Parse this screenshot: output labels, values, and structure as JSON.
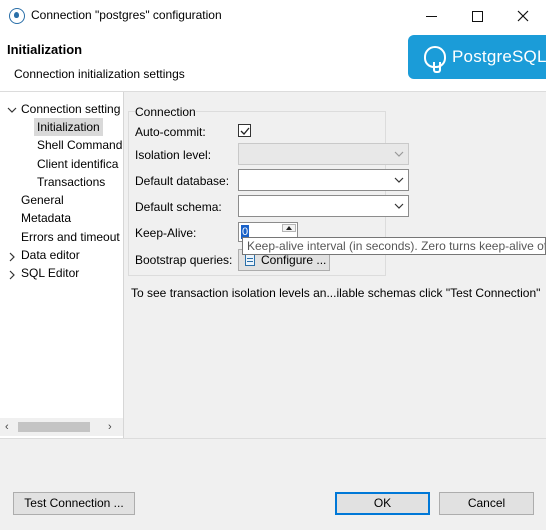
{
  "window": {
    "title": "Connection \"postgres\" configuration",
    "controls": {
      "minimize": "–",
      "maximize": "☐",
      "close": "✕"
    }
  },
  "header": {
    "title": "Initialization",
    "description": "Connection initialization settings",
    "logo_text": "PostgreSQL",
    "logo_color": "#1b9cd8"
  },
  "tree": {
    "items": [
      {
        "label": "Connection setting",
        "expanded": true
      },
      {
        "label": "Initialization",
        "selected": true
      },
      {
        "label": "Shell Command"
      },
      {
        "label": "Client identifica"
      },
      {
        "label": "Transactions"
      },
      {
        "label": "General"
      },
      {
        "label": "Metadata"
      },
      {
        "label": "Errors and timeout"
      },
      {
        "label": "Data editor",
        "expanded": false
      },
      {
        "label": "SQL Editor",
        "expanded": false
      }
    ],
    "scroll_left": "‹",
    "scroll_right": "›"
  },
  "connection": {
    "group_label": "Connection",
    "auto_commit_label": "Auto-commit:",
    "auto_commit_checked": true,
    "isolation_label": "Isolation level:",
    "isolation_value": "",
    "default_database_label": "Default database:",
    "default_database_value": "",
    "default_schema_label": "Default schema:",
    "default_schema_value": "",
    "keepalive_label": "Keep-Alive:",
    "keepalive_value": "0",
    "bootstrap_label": "Bootstrap queries:",
    "configure_button": "Configure ..."
  },
  "tooltip": "Keep-alive interval (in seconds). Zero turns keep-alive off",
  "hint": "To see transaction isolation levels an...ilable schemas click \"Test Connection\"",
  "footer": {
    "test_button": "Test Connection ...",
    "ok_button": "OK",
    "cancel_button": "Cancel"
  }
}
